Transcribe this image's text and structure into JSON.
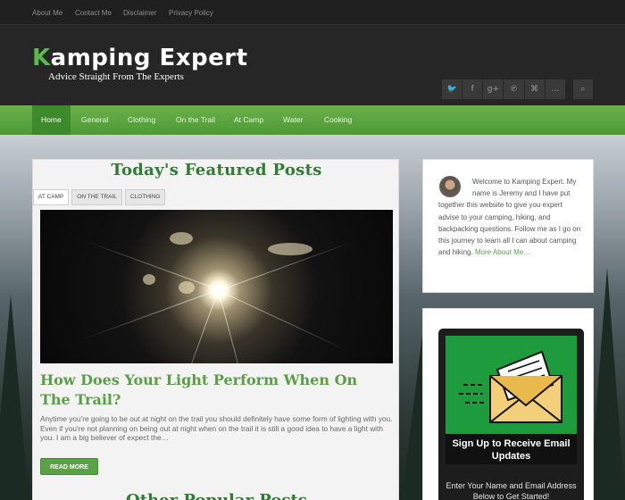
{
  "topbar": {
    "links": [
      "About Me",
      "Contact Me",
      "Disclaimer",
      "Privacy Policy"
    ]
  },
  "header": {
    "logo_first_letter": "K",
    "logo_rest": "amping Expert",
    "tagline": "Advice Straight From The Experts",
    "social_icons": [
      {
        "name": "twitter-icon",
        "glyph": "🐦"
      },
      {
        "name": "facebook-icon",
        "glyph": "f"
      },
      {
        "name": "googleplus-icon",
        "glyph": "g+"
      },
      {
        "name": "pinterest-icon",
        "glyph": "℗"
      },
      {
        "name": "rss-icon",
        "glyph": "⌘"
      },
      {
        "name": "more-icon",
        "glyph": "…"
      }
    ],
    "search_glyph": "⌕"
  },
  "nav": {
    "items": [
      "Home",
      "General",
      "Clothing",
      "On the Trail",
      "At Camp",
      "Water",
      "Cooking"
    ],
    "active": "Home"
  },
  "main": {
    "featured_title": "Today's Featured Posts",
    "tabs": [
      "At Camp",
      "On the Trail",
      "Clothing"
    ],
    "active_tab": "At Camp",
    "post_title": "How Does Your Light Perform When On The Trail?",
    "excerpt": "Anytime you're going to be out at night on the trail you should definitely have some form of lighting with you. Even if you're not planning on being out at night when on the trail it is still a good idea to have a light with you. I am a big believer of expect the…",
    "read_more": "READ MORE",
    "other_title": "Other Popular Posts"
  },
  "sidebar": {
    "about_text": "Welcome to Kamping Expert. My name is Jeremy and I have put together this website to give you expert advise to your camping, hiking, and backpacking questions. Follow me as I go on this journey to learn all I can about camping and hiking.",
    "more_link": "More About Me…",
    "signup_heading": "Sign Up to Receive Email Updates",
    "signup_sub": "Enter Your Name and Email Address Below to Get Started!"
  },
  "colors": {
    "accent_green": "#5ba146",
    "nav_green": "#6ab04c",
    "title_green": "#2e7d32"
  }
}
